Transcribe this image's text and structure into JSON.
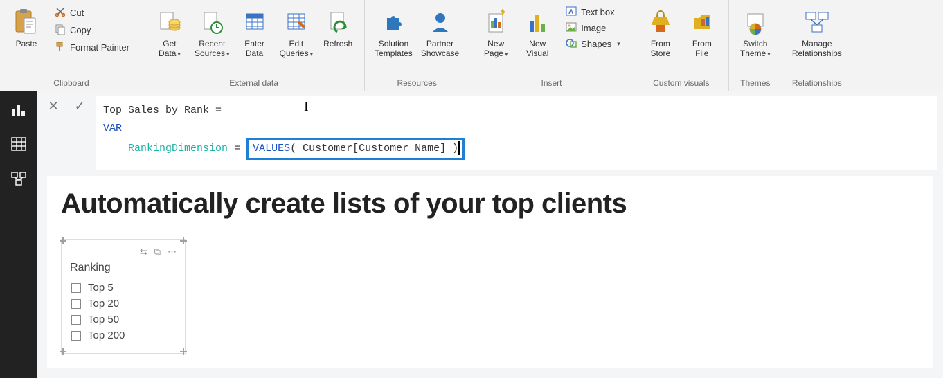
{
  "ribbon": {
    "clipboard": {
      "label": "Clipboard",
      "paste": "Paste",
      "cut": "Cut",
      "copy": "Copy",
      "format_painter": "Format Painter"
    },
    "external_data": {
      "label": "External data",
      "get_data": "Get\nData",
      "recent_sources": "Recent\nSources",
      "enter_data": "Enter\nData",
      "edit_queries": "Edit\nQueries",
      "refresh": "Refresh"
    },
    "resources": {
      "label": "Resources",
      "solution_templates": "Solution\nTemplates",
      "partner_showcase": "Partner\nShowcase"
    },
    "insert": {
      "label": "Insert",
      "new_page": "New\nPage",
      "new_visual": "New\nVisual",
      "text_box": "Text box",
      "image": "Image",
      "shapes": "Shapes"
    },
    "custom_visuals": {
      "label": "Custom visuals",
      "from_store": "From\nStore",
      "from_file": "From\nFile"
    },
    "themes": {
      "label": "Themes",
      "switch_theme": "Switch\nTheme"
    },
    "relationships": {
      "label": "Relationships",
      "manage": "Manage\nRelationships"
    }
  },
  "formula": {
    "line1_prefix": "Top Sales by Rank =",
    "var_kw": "VAR",
    "var_name": "RankingDimension",
    "equals": "=",
    "func": "VALUES",
    "open": "(",
    "arg": " Customer[Customer Name] ",
    "close": ")"
  },
  "report": {
    "headline": "Automatically create lists of your top clients",
    "slicer_title": "Ranking",
    "dots": "⋯",
    "slicer_items": [
      "Top 5",
      "Top 20",
      "Top 50",
      "Top 200"
    ]
  }
}
